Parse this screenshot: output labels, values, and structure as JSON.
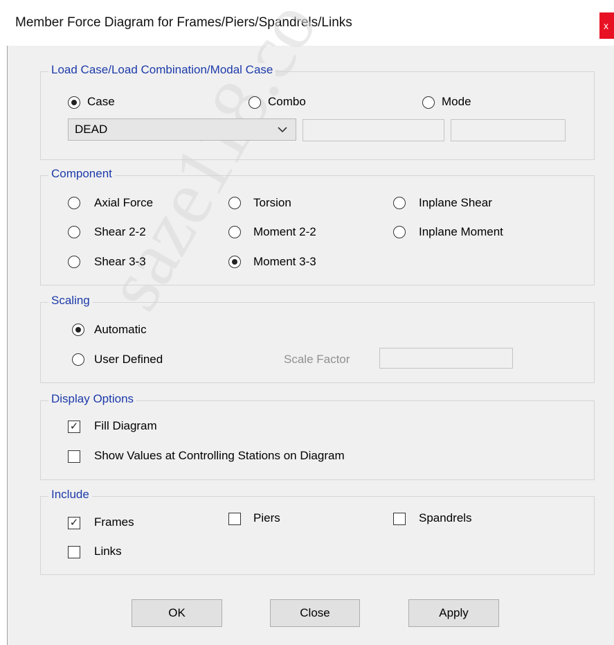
{
  "window": {
    "title": "Member Force Diagram for Frames/Piers/Spandrels/Links",
    "close_glyph": "x"
  },
  "watermark": "saze118.co",
  "load_case": {
    "legend": "Load Case/Load Combination/Modal Case",
    "options": [
      "Case",
      "Combo",
      "Mode"
    ],
    "selected": "Case",
    "case_value": "DEAD"
  },
  "component": {
    "legend": "Component",
    "options": [
      "Axial Force",
      "Torsion",
      "Inplane Shear",
      "Shear 2-2",
      "Moment 2-2",
      "Inplane Moment",
      "Shear 3-3",
      "Moment 3-3"
    ],
    "selected": "Moment 3-3"
  },
  "scaling": {
    "legend": "Scaling",
    "options": [
      "Automatic",
      "User Defined"
    ],
    "selected": "Automatic",
    "scale_factor_label": "Scale Factor",
    "scale_factor_value": ""
  },
  "display_options": {
    "legend": "Display Options",
    "fill_diagram": {
      "label": "Fill Diagram",
      "checked": true
    },
    "show_values": {
      "label": "Show Values at Controlling Stations on Diagram",
      "checked": false
    }
  },
  "include": {
    "legend": "Include",
    "frames": {
      "label": "Frames",
      "checked": true
    },
    "piers": {
      "label": "Piers",
      "checked": false
    },
    "spandrels": {
      "label": "Spandrels",
      "checked": false
    },
    "links": {
      "label": "Links",
      "checked": false
    }
  },
  "buttons": {
    "ok": "OK",
    "close": "Close",
    "apply": "Apply"
  },
  "colors": {
    "legend_text": "#1c3aa9",
    "dialog_bg": "#f0f0f0",
    "close_button": "#e81123"
  }
}
